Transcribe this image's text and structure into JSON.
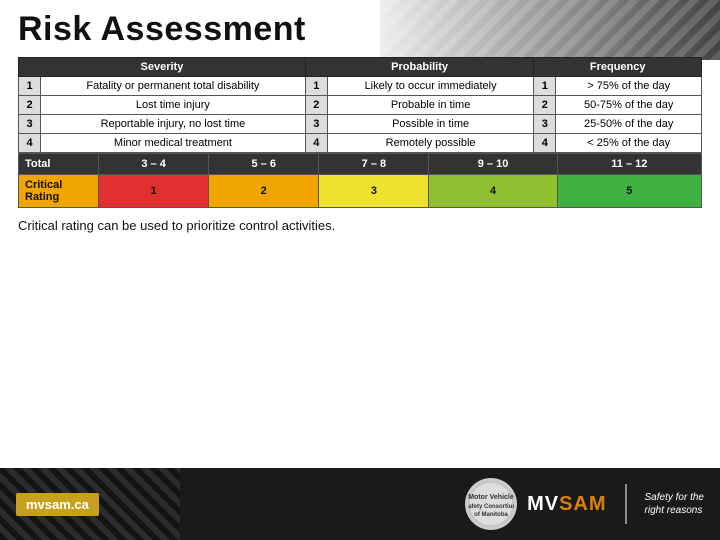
{
  "page": {
    "title": "Risk Assessment"
  },
  "top_table": {
    "headers": [
      "#",
      "Severity",
      "#",
      "Probability",
      "#",
      "Frequency"
    ],
    "rows": [
      {
        "sev_num": "1",
        "sev_text": "Fatality or permanent total disability",
        "prob_num": "1",
        "prob_text": "Likely to occur immediately",
        "freq_num": "1",
        "freq_text": "> 75% of the day"
      },
      {
        "sev_num": "2",
        "sev_text": "Lost time injury",
        "prob_num": "2",
        "prob_text": "Probable in time",
        "freq_num": "2",
        "freq_text": "50-75% of the day"
      },
      {
        "sev_num": "3",
        "sev_text": "Reportable injury, no lost time",
        "prob_num": "3",
        "prob_text": "Possible in time",
        "freq_num": "3",
        "freq_text": "25-50% of the day"
      },
      {
        "sev_num": "4",
        "sev_text": "Minor medical treatment",
        "prob_num": "4",
        "prob_text": "Remotely possible",
        "freq_num": "4",
        "freq_text": "< 25% of the day"
      }
    ]
  },
  "bottom_table": {
    "total_row": {
      "label": "Total",
      "ranges": [
        "3 – 4",
        "5 – 6",
        "7 – 8",
        "9 – 10",
        "11 – 12"
      ]
    },
    "critical_row": {
      "label": "Critical Rating",
      "values": [
        "1",
        "2",
        "3",
        "4",
        "5"
      ]
    }
  },
  "caption": "Critical rating can be used to prioritize control activities.",
  "footer": {
    "url": "mvsam.ca",
    "logo_text": "MVSAM",
    "tagline_line1": "Safety for the",
    "tagline_line2": "right reasons",
    "org_text": "Motor Vehicle Safety Consortium of Manitoba"
  }
}
